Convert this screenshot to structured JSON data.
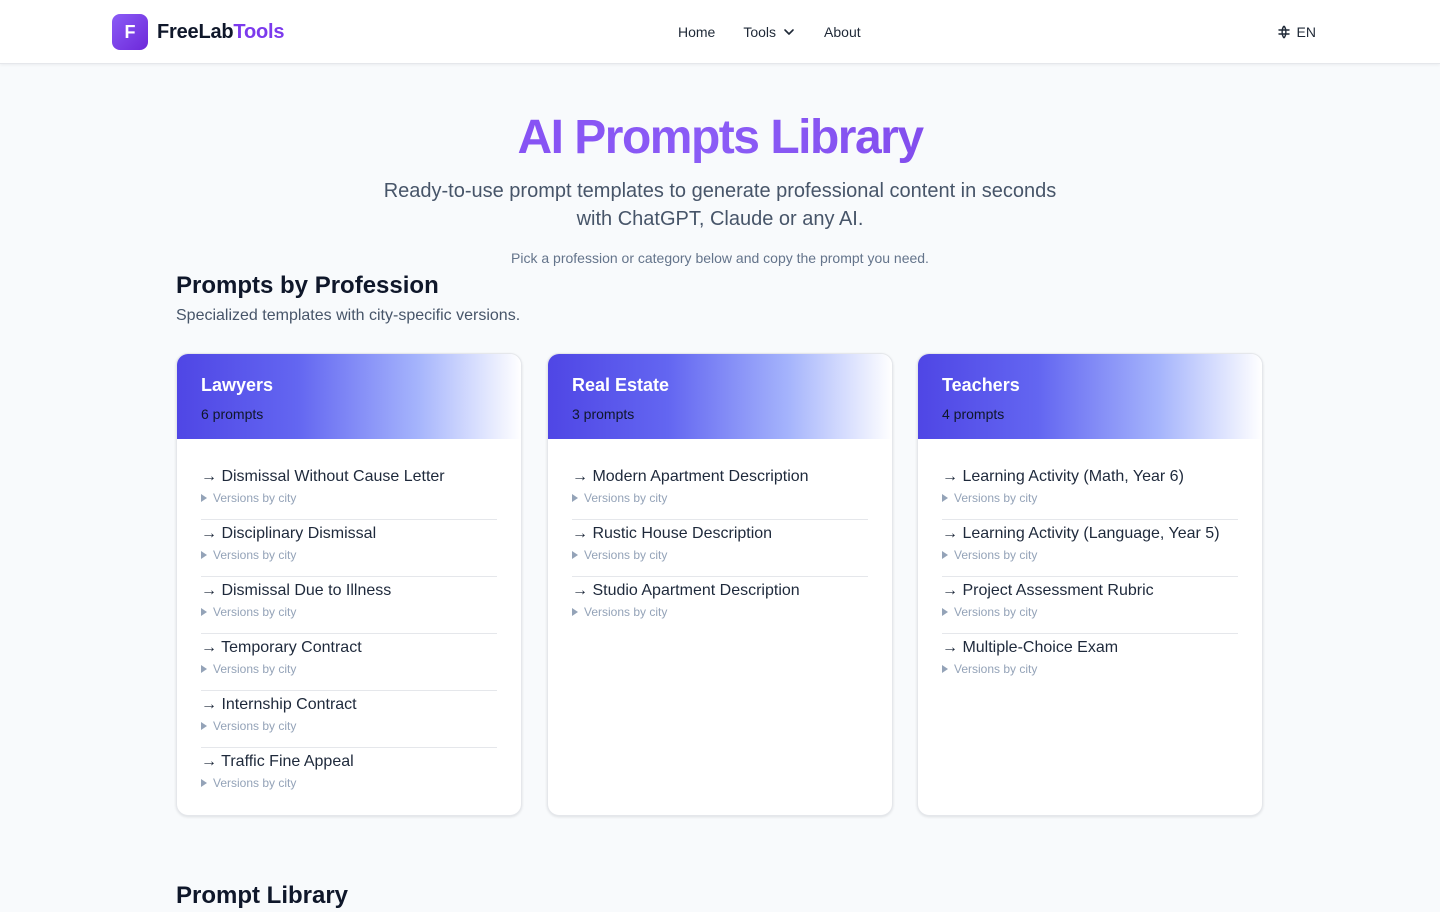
{
  "header": {
    "logo_letter": "F",
    "brand_part1": "FreeLab",
    "brand_part2": "Tools",
    "nav": {
      "home": "Home",
      "tools": "Tools",
      "about": "About"
    },
    "language": "EN"
  },
  "hero": {
    "title": "AI Prompts Library",
    "subtitle": "Ready-to-use prompt templates to generate professional content in seconds with ChatGPT, Claude or any AI.",
    "hint": "Pick a profession or category below and copy the prompt you need."
  },
  "professions": {
    "title": "Prompts by Profession",
    "subtitle": "Specialized templates with city-specific versions.",
    "cards": [
      {
        "name": "Lawyers",
        "count": "6 prompts",
        "items": [
          {
            "label": "→ Dismissal Without Cause Letter",
            "versions": "Versions by city"
          },
          {
            "label": "→ Disciplinary Dismissal",
            "versions": "Versions by city"
          },
          {
            "label": "→ Dismissal Due to Illness",
            "versions": "Versions by city"
          },
          {
            "label": "→ Temporary Contract",
            "versions": "Versions by city"
          },
          {
            "label": "→ Internship Contract",
            "versions": "Versions by city"
          },
          {
            "label": "→ Traffic Fine Appeal",
            "versions": "Versions by city"
          }
        ]
      },
      {
        "name": "Real Estate",
        "count": "3 prompts",
        "items": [
          {
            "label": "→ Modern Apartment Description",
            "versions": "Versions by city"
          },
          {
            "label": "→ Rustic House Description",
            "versions": "Versions by city"
          },
          {
            "label": "→ Studio Apartment Description",
            "versions": "Versions by city"
          }
        ]
      },
      {
        "name": "Teachers",
        "count": "4 prompts",
        "items": [
          {
            "label": "→ Learning Activity (Math, Year 6)",
            "versions": "Versions by city"
          },
          {
            "label": "→ Learning Activity (Language, Year 5)",
            "versions": "Versions by city"
          },
          {
            "label": "→ Project Assessment Rubric",
            "versions": "Versions by city"
          },
          {
            "label": "→ Multiple-Choice Exam",
            "versions": "Versions by city"
          }
        ]
      }
    ]
  },
  "library": {
    "title": "Prompt Library"
  },
  "colors": {
    "accent": "#7c3aed",
    "card_gradient_start": "#4f46e5",
    "background": "#f8fafc"
  },
  "icons": {
    "nav_dropdown": "chevron-down-icon",
    "language": "globe-icon",
    "item_expand": "triangle-right-icon"
  }
}
